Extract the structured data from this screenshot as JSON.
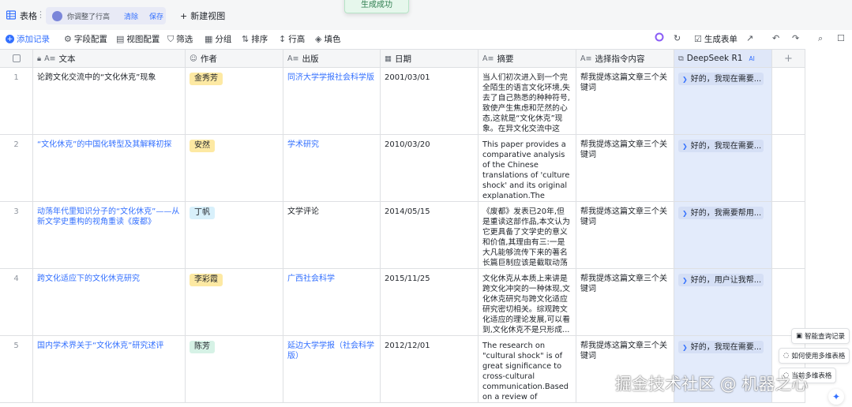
{
  "topbar": {
    "table_name": "表格",
    "change_msg": "你调整了行高",
    "clear_label": "清除",
    "save_label": "保存",
    "new_view_label": "新建视图",
    "toast": "生成成功"
  },
  "toolbar": {
    "add_record": "添加记录",
    "field_config": "字段配置",
    "view_config": "视图配置",
    "filter": "筛选",
    "group": "分组",
    "sort": "排序",
    "row_height": "行高",
    "fill_color": "填色",
    "generate_form": "生成表单"
  },
  "columns": {
    "text": "文本",
    "author": "作者",
    "publisher": "出版",
    "date": "日期",
    "summary": "摘要",
    "instruction": "选择指令内容",
    "ai": "DeepSeek R1",
    "ai_tag": "AI"
  },
  "rows": [
    {
      "num": "1",
      "title": "论跨文化交流中的“文化休克”现象",
      "author": "金秀芳",
      "publisher": "同济大学学报社会科学版",
      "date": "2001/03/01",
      "summary": "当人们初次进入到一个完全陌生的语言文化环境,失去了自己熟悉的种种符号,致使产生焦虑和茫然的心态,这就是“文化休克”现象。在异文化交流中这是...",
      "instruction": "帮我提炼这篇文章三个关键词",
      "ai": "好的，我现在需要..."
    },
    {
      "num": "2",
      "title": "“文化休克”的中国化转型及其解释初探",
      "author": "安然",
      "publisher": "学术研究",
      "date": "2010/03/20",
      "summary": "This paper provides a comparative analysis of the Chinese translations of 'culture shock' and its original explanation.The meaning of 'culture...",
      "instruction": "帮我提炼这篇文章三个关键词",
      "ai": "好的，我现在需要..."
    },
    {
      "num": "3",
      "title": "动荡年代里知识分子的“文化休克”——从新文学史重构的视角重读《废都》",
      "author": "丁帆",
      "publisher": "文学评论",
      "date": "2014/05/15",
      "summary": "《废都》发表已20年,但是重读这部作品,本文认为它更具备了文学史的意义和价值,其理由有三:一是大凡能够流传下来的著名长篇巨制应该是截取动荡时...",
      "instruction": "帮我提炼这篇文章三个关键词",
      "ai": "好的，我需要帮用..."
    },
    {
      "num": "4",
      "title": "跨文化适应下的文化休克研究",
      "author": "李彩霞",
      "publisher": "广西社会科学",
      "date": "2015/11/25",
      "summary": "文化休克从本质上来讲是跨文化冲突的一种体现,文化休克研究与跨文化适应研究密切相关。综观跨文化适应的理论发展,可以看到,文化休克不是只形成...",
      "instruction": "帮我提炼这篇文章三个关键词",
      "ai": "好的，用户让我帮..."
    },
    {
      "num": "5",
      "title": "国内学术界关于“文化休克”研究述评",
      "author": "陈芳",
      "publisher": "延边大学学报（社会科学版）",
      "date": "2012/12/01",
      "summary": "The research on \"cultural shock\" is of great significance to cross-cultural communication.Based on a review of present...",
      "instruction": "帮我提炼这篇文章三个关键词",
      "ai": "好的，我现在需要..."
    }
  ],
  "side_buttons": {
    "smart_query": "智能查询记录",
    "multi_table": "如何使用多维表格",
    "overlay": "当前多维表格"
  },
  "watermark": "掘金技术社区 @ 机器之心",
  "colors": {
    "accent": "#3370ff",
    "author_tags": [
      "#fde9a3",
      "#fde9a3",
      "#d8f0fb",
      "#fde9a3",
      "#d6f2e6"
    ],
    "ai_column": "#e3ebfb"
  }
}
